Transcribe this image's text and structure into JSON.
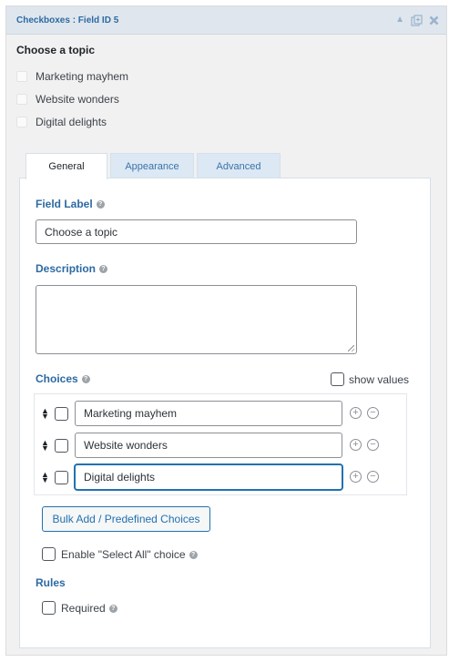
{
  "header": {
    "title": "Checkboxes : Field ID 5",
    "icons": [
      "collapse-up-icon",
      "duplicate-icon",
      "delete-icon"
    ]
  },
  "preview": {
    "field_label": "Choose a topic",
    "choices": [
      "Marketing mayhem",
      "Website wonders",
      "Digital delights"
    ]
  },
  "tabs": [
    {
      "label": "General",
      "active": true
    },
    {
      "label": "Appearance",
      "active": false
    },
    {
      "label": "Advanced",
      "active": false
    }
  ],
  "general": {
    "field_label_title": "Field Label",
    "field_label_value": "Choose a topic",
    "description_title": "Description",
    "description_value": "",
    "choices_title": "Choices",
    "show_values_label": "show values",
    "choices": [
      {
        "label": "Marketing mayhem",
        "checked": false,
        "focused": false
      },
      {
        "label": "Website wonders",
        "checked": false,
        "focused": false
      },
      {
        "label": "Digital delights",
        "checked": false,
        "focused": true
      }
    ],
    "bulk_add_label": "Bulk Add / Predefined Choices",
    "select_all_label": "Enable \"Select All\" choice",
    "rules_title": "Rules",
    "required_label": "Required"
  },
  "colors": {
    "header_bg": "#dfe6ed",
    "accent": "#2c6aa3",
    "tab_inactive_bg": "#dce8f3",
    "focus_border": "#2271b1"
  }
}
